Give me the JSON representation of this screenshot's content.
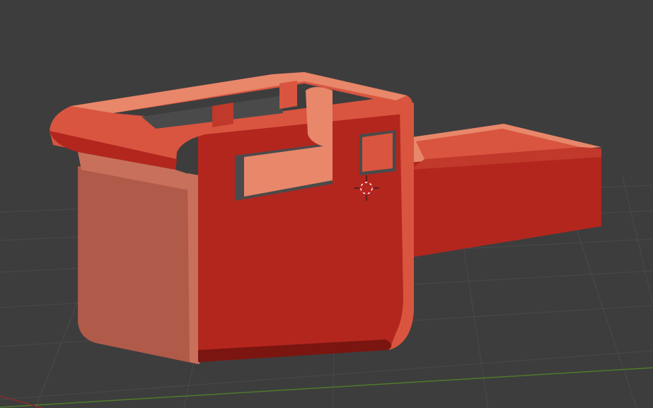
{
  "viewport": {
    "background": "#3d3d3d",
    "grid_color": "#4a4a4a",
    "x_axis_color": "#8b2a2a",
    "y_axis_color": "#4f7a2a",
    "grid_visible": true
  },
  "model": {
    "object_type": "mesh",
    "color_base": "#b3261e",
    "color_light": "#d9553f",
    "color_highlight": "#e8876a",
    "color_shadow": "#7a1510",
    "color_side": "#b05a4a"
  },
  "cursor": {
    "icon": "3d-cursor-crosshair-icon",
    "colors": [
      "#ffffff",
      "#cc2222"
    ]
  }
}
